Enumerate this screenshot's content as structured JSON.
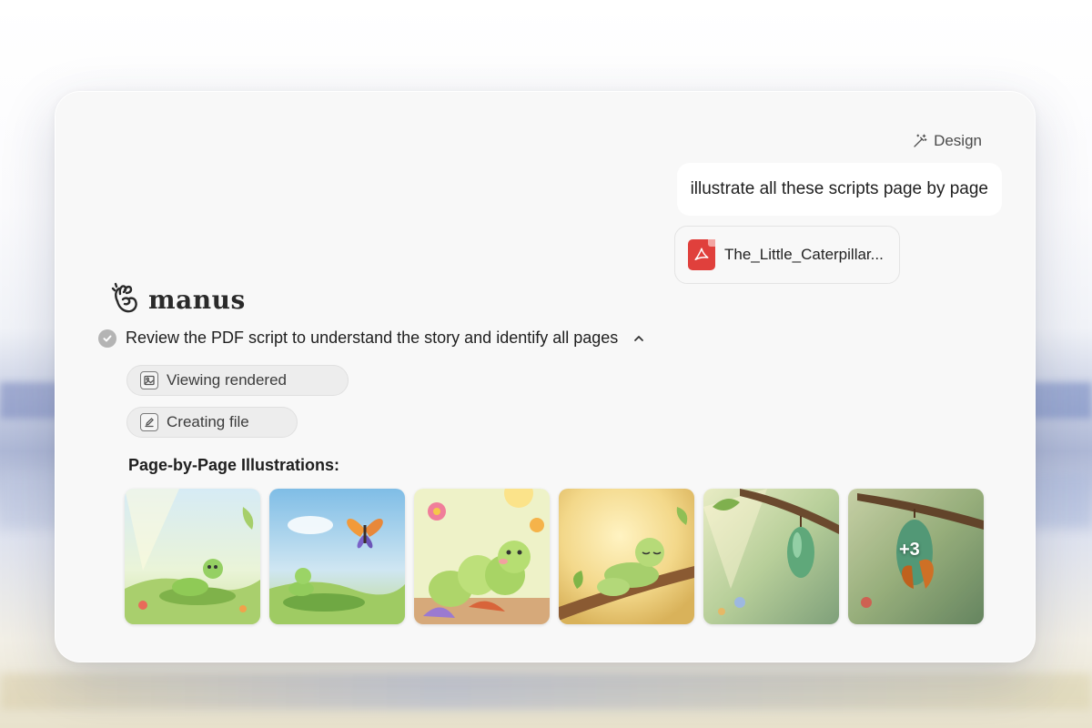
{
  "header": {
    "design_label": "Design"
  },
  "user_message": {
    "text": "illustrate all these scripts page by page"
  },
  "attachment": {
    "file_name": "The_Little_Caterpillar...",
    "icon": "pdf-file-icon"
  },
  "brand": {
    "name": "manus",
    "icon": "manus-hand-icon"
  },
  "task": {
    "status": "completed",
    "title": "Review the PDF script to understand the story and identify all pages",
    "steps": [
      {
        "label": "Viewing rendered",
        "icon": "image-icon"
      },
      {
        "label": "Creating file",
        "icon": "pencil-edit-icon"
      }
    ]
  },
  "illustrations": {
    "heading": "Page-by-Page Illustrations:",
    "thumbnails": [
      {
        "scene": "caterpillar-on-leaf-meadow"
      },
      {
        "scene": "caterpillar-with-butterfly"
      },
      {
        "scene": "caterpillar-eating-leaf-flowers"
      },
      {
        "scene": "sleepy-caterpillar-on-branch"
      },
      {
        "scene": "chrysalis-hanging-branch"
      },
      {
        "scene": "butterfly-emerging-chrysalis"
      }
    ],
    "more_count": "+3"
  },
  "colors": {
    "pdf_red": "#e0403c",
    "card_bg": "#f8f8f8"
  }
}
